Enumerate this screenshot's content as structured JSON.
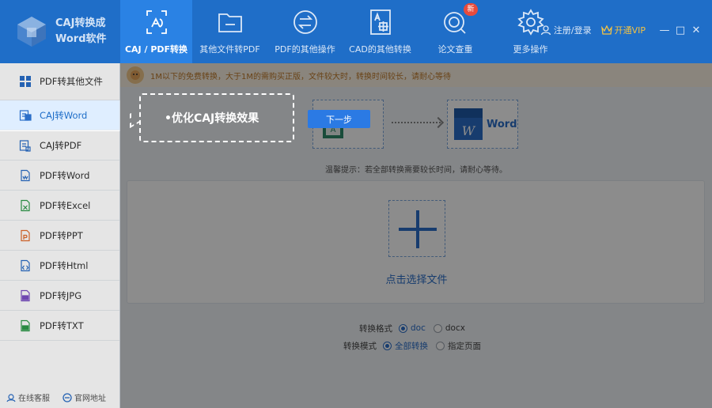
{
  "app": {
    "title_line1": "CAJ转换成",
    "title_line2": "Word软件"
  },
  "tabs": [
    {
      "label": "CAJ / PDF转换",
      "icon": "caj-pdf-convert-icon",
      "active": true
    },
    {
      "label": "其他文件转PDF",
      "icon": "folder-icon",
      "active": false
    },
    {
      "label": "PDF的其他操作",
      "icon": "swap-circle-icon",
      "active": false
    },
    {
      "label": "CAD的其他转换",
      "icon": "cad-document-icon",
      "active": false
    },
    {
      "label": "论文查重",
      "icon": "search-target-icon",
      "active": false,
      "badge": "新"
    },
    {
      "label": "更多操作",
      "icon": "gear-icon",
      "active": false
    }
  ],
  "header_right": {
    "login": "注册/登录",
    "vip": "开通VIP"
  },
  "sidebar": {
    "header": "PDF转其他文件",
    "items": [
      {
        "label": "CAJ转Word",
        "active": true
      },
      {
        "label": "CAJ转PDF"
      },
      {
        "label": "PDF转Word"
      },
      {
        "label": "PDF转Excel"
      },
      {
        "label": "PDF转PPT"
      },
      {
        "label": "PDF转Html"
      },
      {
        "label": "PDF转JPG"
      },
      {
        "label": "PDF转TXT"
      }
    ],
    "bottom": {
      "service": "在线客服",
      "website": "官网地址"
    }
  },
  "main": {
    "notice": "1M以下的免费转换，大于1M的需购买正版，文件较大时，转换时间较长，请耐心等待",
    "flow_target": "Word",
    "tip": "温馨提示：若全部转换需要较长时间，请耐心等待。",
    "drop_label": "点击选择文件",
    "format_label": "转换格式",
    "format_options": [
      "doc",
      "docx"
    ],
    "mode_label": "转换模式",
    "mode_options": [
      "全部转换",
      "指定页面"
    ]
  },
  "guide": {
    "text": "•优化CAJ转换效果",
    "next": "下一步"
  },
  "colors": {
    "header_bg": "#1f6ec8",
    "accent": "#2a82e4",
    "vip": "#f5c342"
  }
}
